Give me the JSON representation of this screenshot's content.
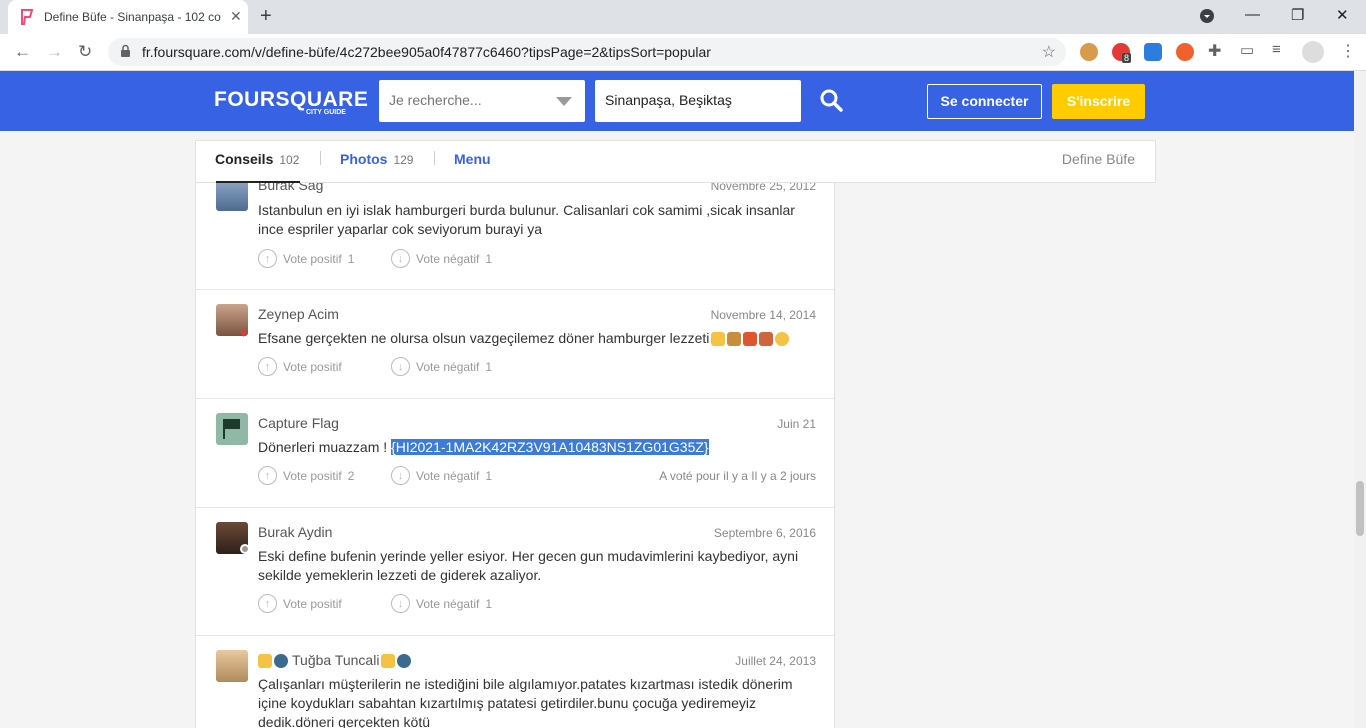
{
  "browser": {
    "tab_title": "Define Büfe - Sinanpaşa - 102 co",
    "new_tab": "+",
    "url": "fr.foursquare.com/v/define-büfe/4c272bee905a0f47877c6460?tipsPage=2&tipsSort=popular",
    "ext_badge": "8"
  },
  "header": {
    "logo": "FOURSQUARE",
    "logo_sub": "CITY GUIDE",
    "search_placeholder": "Je recherche...",
    "location_value": "Sinanpaşa, Beşiktaş",
    "login_label": "Se connecter",
    "signup_label": "S'inscrire",
    "brand_color": "#3762e4",
    "signup_color": "#ffcc00"
  },
  "subnav": {
    "tabs": [
      {
        "label": "Conseils",
        "count": "102"
      },
      {
        "label": "Photos",
        "count": "129"
      },
      {
        "label": "Menu",
        "count": ""
      }
    ],
    "venue": "Define Büfe"
  },
  "tips": [
    {
      "user": "Burak Sag",
      "date": "Novembre 25, 2012",
      "text": "Istanbulun en iyi islak hamburgeri burda bulunur. Calisanlari cok samimi ,sicak insanlar ince espriler yaparlar cok seviyorum burayi ya",
      "up_label": "Vote positif",
      "up_count": "1",
      "down_label": "Vote négatif",
      "down_count": "1"
    },
    {
      "user": "Zeynep Acim",
      "date": "Novembre 14, 2014",
      "text": "Efsane gerçekten ne olursa olsun vazgeçilemez döner hamburger lezzeti",
      "up_label": "Vote positif",
      "up_count": "",
      "down_label": "Vote négatif",
      "down_count": "1"
    },
    {
      "user": "Capture Flag",
      "date": "Juin 21",
      "text_prefix": "Dönerleri muazzam ! ",
      "text_highlight": "{HI2021-1MA2K42RZ3V91A10483NS1ZG01G35Z}",
      "up_label": "Vote positif",
      "up_count": "2",
      "down_label": "Vote négatif",
      "down_count": "1",
      "voted": "A voté pour il y a Il y a 2 jours"
    },
    {
      "user": "Burak Aydin",
      "date": "Septembre 6, 2016",
      "text": "Eski define bufenin yerinde yeller esiyor. Her gecen gun mudavimlerini kaybediyor, ayni sekilde yemeklerin lezzeti de giderek azaliyor.",
      "up_label": "Vote positif",
      "up_count": "",
      "down_label": "Vote négatif",
      "down_count": "1"
    },
    {
      "user": "Tuğba Tuncali",
      "date": "Juillet 24, 2013",
      "text": "Çalışanları müşterilerin ne istediğini bile algılamıyor.patates kızartması istedik dönerim içine koydukları sabahtan kızartılmış patatesi getirdiler.bunu çocuğa yediremeyiz dedik.döneri gerçekten kötü"
    }
  ]
}
